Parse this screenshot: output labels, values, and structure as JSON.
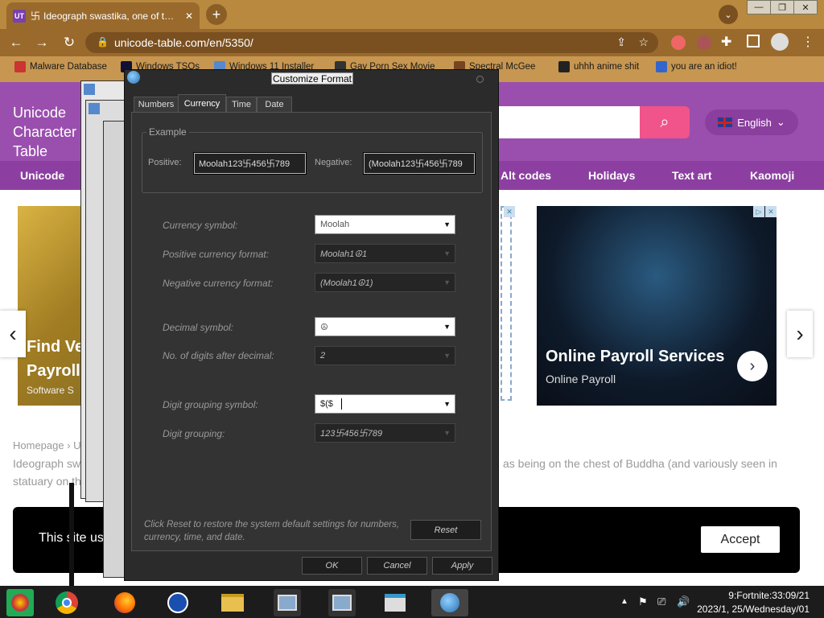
{
  "browser": {
    "tab_title": "Ideograph swastika, one of t…",
    "tab_favicon": "UT",
    "tab_glyph": "卐",
    "url": "unicode-table.com/en/5350/",
    "bookmarks": [
      "Malware Database",
      "Windows TSOs",
      "Windows 11 Installer",
      "Gay Porn Sex Movie",
      "Spectral McGee",
      "uhhh anime shit",
      "you are an idiot!"
    ]
  },
  "site": {
    "logo": "Unicode Character Table",
    "language": "English",
    "nav": [
      "Unicode",
      "Alt codes",
      "Holidays",
      "Text art",
      "Kaomoji"
    ],
    "ad_left_title": "Find Ve… Payroll",
    "ad_left_sub": "Software S",
    "ad_right_title": "Online Payroll Services",
    "ad_right_sub": "Online Payroll",
    "breadcrumb": "Homepage › U",
    "para_left_1": "Ideograph sw",
    "para_left_2": "statuary on th",
    "para_right": "as being on the chest of Buddha (and variously seen in",
    "cookie_text": "This site us",
    "accept_label": "Accept"
  },
  "dialog": {
    "title": "Customize Format",
    "tabs": [
      "Numbers",
      "Currency",
      "Time",
      "Date"
    ],
    "active_tab": "Currency",
    "example_legend": "Example",
    "positive_label": "Positive:",
    "positive_value": "Moolah123卐456卐789",
    "negative_label": "Negative:",
    "negative_value": "(Moolah123卐456卐789",
    "fields": {
      "currency_symbol": {
        "label": "Currency symbol:",
        "value": "Moolah"
      },
      "positive_format": {
        "label": "Positive currency format:",
        "value": "Moolah1☮1"
      },
      "negative_format": {
        "label": "Negative currency format:",
        "value": "(Moolah1☮1)"
      },
      "decimal_symbol": {
        "label": "Decimal symbol:",
        "value": "☮"
      },
      "digits_after_decimal": {
        "label": "No. of digits after decimal:",
        "value": "2"
      },
      "digit_grouping_symbol": {
        "label": "Digit grouping symbol:",
        "value": "$($"
      },
      "digit_grouping": {
        "label": "Digit grouping:",
        "value": "123卐456卐789"
      }
    },
    "reset_text": "Click Reset to restore the system default settings for numbers, currency, time, and date.",
    "reset_label": "Reset",
    "ok_label": "OK",
    "cancel_label": "Cancel",
    "apply_label": "Apply"
  },
  "taskbar": {
    "clock_line1": "9:Fortnite:33:09/21",
    "clock_line2": "2023/1, 25/Wednesday/01"
  }
}
